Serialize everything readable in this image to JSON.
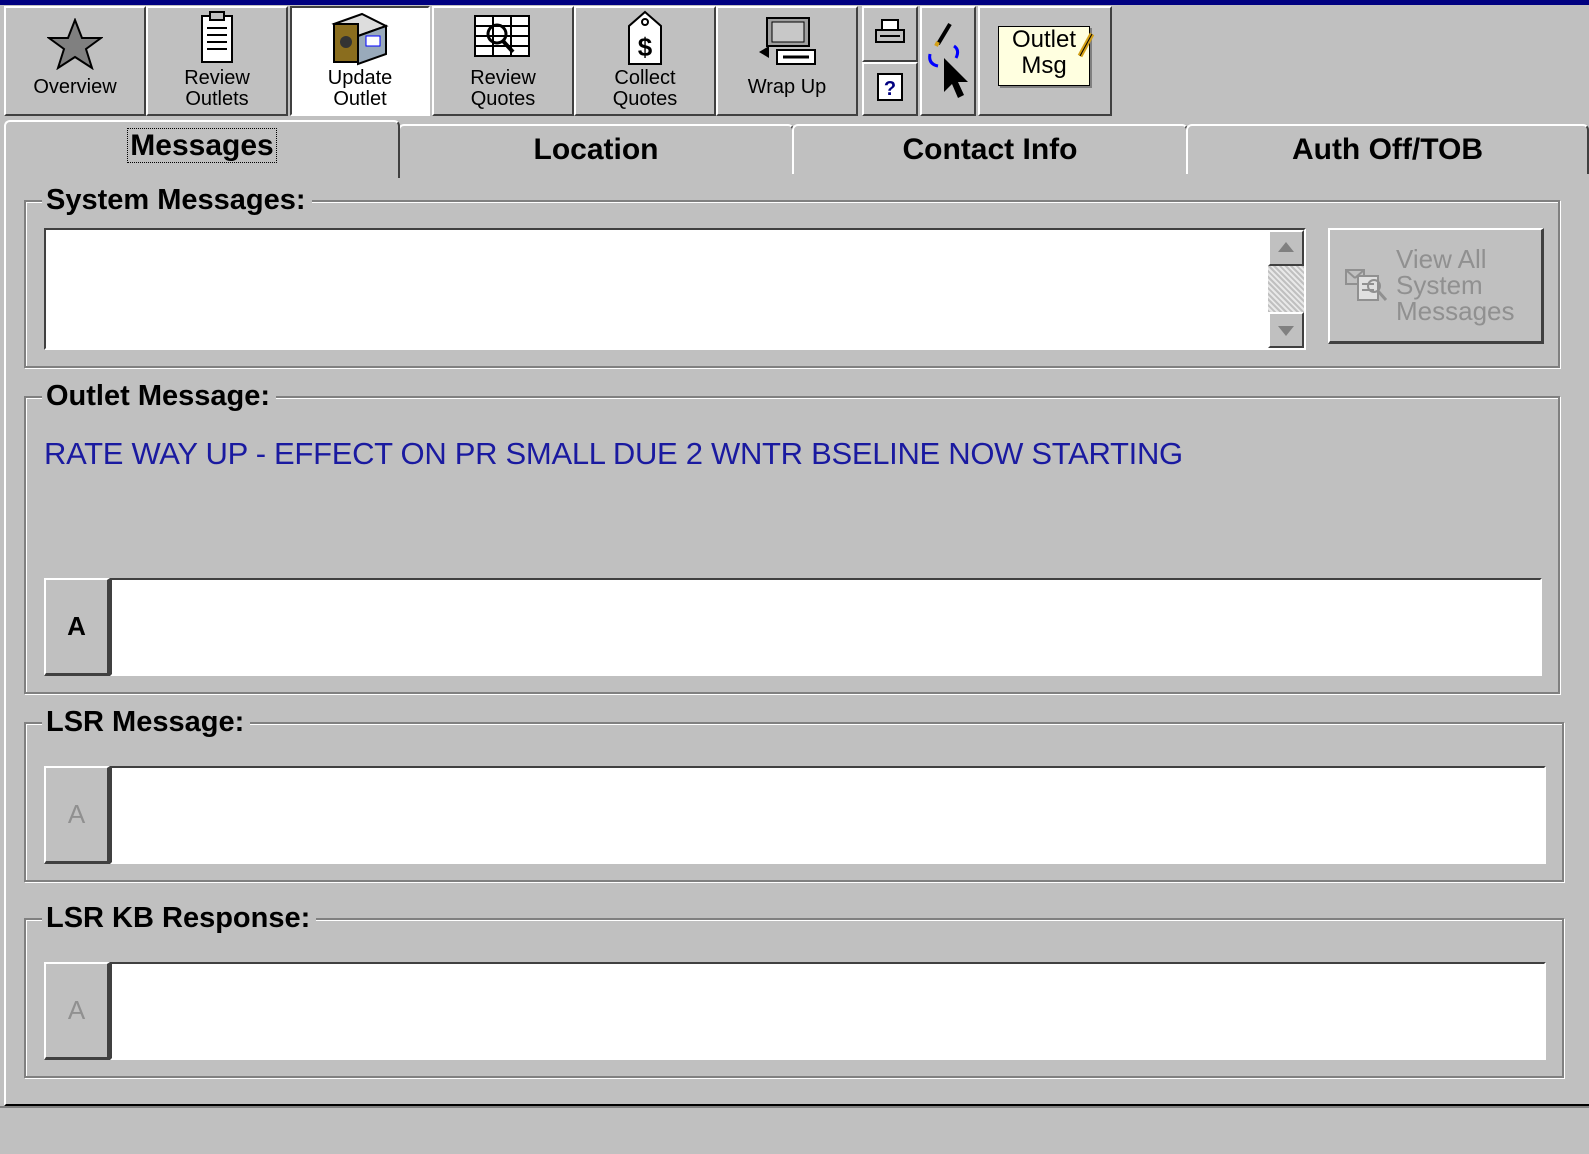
{
  "toolbar": {
    "overview": "Overview",
    "review_outlets": [
      "Review",
      "Outlets"
    ],
    "update_outlet": [
      "Update",
      "Outlet"
    ],
    "review_quotes": [
      "Review",
      "Quotes"
    ],
    "collect_quotes": [
      "Collect",
      "Quotes"
    ],
    "wrap_up": "Wrap Up",
    "outlet_msg": [
      "Outlet",
      "Msg"
    ]
  },
  "tabs": [
    "Messages",
    "Location",
    "Contact Info",
    "Auth Off/TOB"
  ],
  "system_messages": {
    "legend": "System Messages:",
    "text": "",
    "view_all": [
      "View All",
      "System",
      "Messages"
    ]
  },
  "outlet_message": {
    "legend": "Outlet Message:",
    "text": "RATE WAY UP - EFFECT ON PR SMALL DUE 2 WNTR BSELINE NOW STARTING",
    "button": "A",
    "input_value": ""
  },
  "lsr_message": {
    "legend": "LSR Message:",
    "button": "A",
    "input_value": ""
  },
  "lsr_kb_response": {
    "legend": "LSR KB Response:",
    "button": "A",
    "input_value": ""
  },
  "colors": {
    "title_bar": "#000080",
    "face": "#c0c0c0",
    "outlet_message_text": "#1a1aa0",
    "disabled_text": "#909090"
  }
}
